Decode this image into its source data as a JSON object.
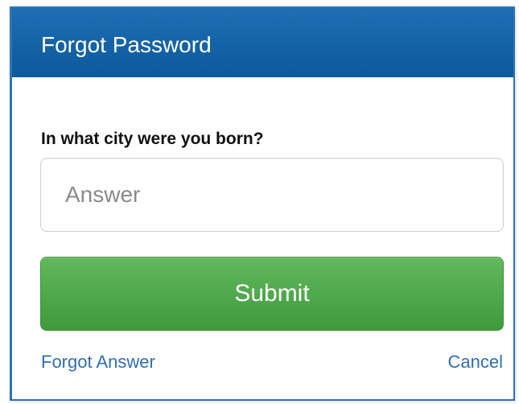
{
  "dialog": {
    "title": "Forgot Password"
  },
  "form": {
    "question": "In what city were you born?",
    "answer_placeholder": "Answer",
    "answer_value": "",
    "submit_label": "Submit"
  },
  "links": {
    "forgot_answer": "Forgot Answer",
    "cancel": "Cancel"
  },
  "colors": {
    "header_blue": "#0c5a9c",
    "submit_green": "#4aa846",
    "link_blue": "#2f6fb3"
  }
}
